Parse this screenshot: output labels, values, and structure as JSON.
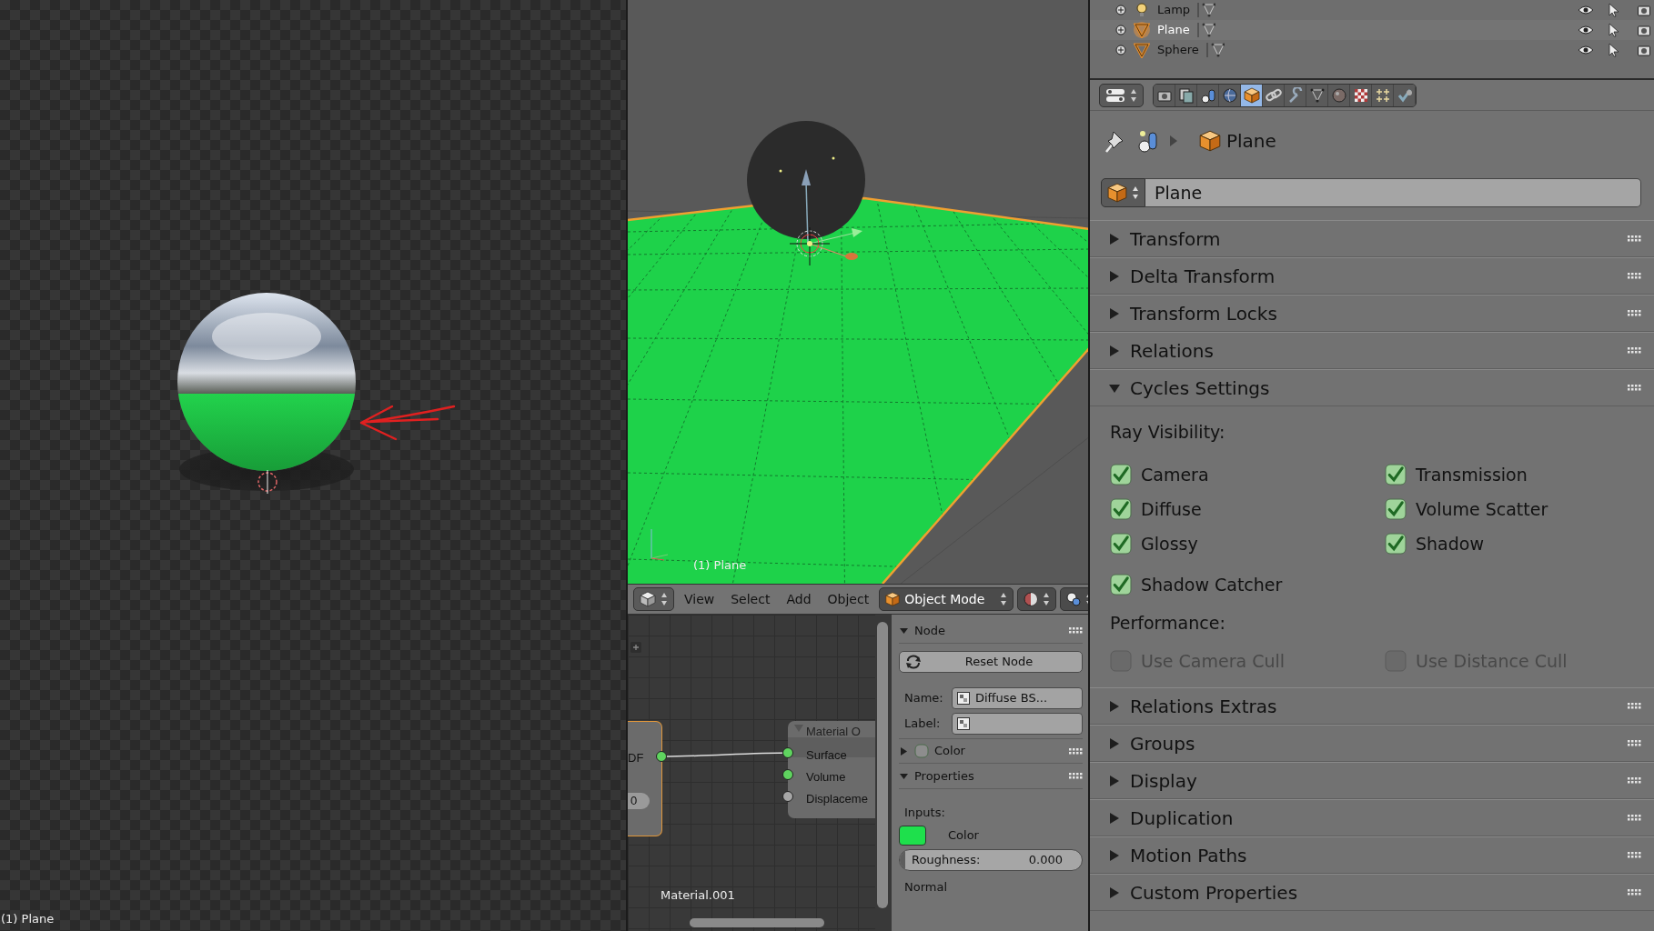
{
  "render_view": {
    "status": "(1) Plane"
  },
  "viewport": {
    "status": "(1) Plane"
  },
  "viewport_header": {
    "menus": [
      "View",
      "Select",
      "Add",
      "Object"
    ],
    "mode": "Object Mode"
  },
  "node_editor": {
    "left_node": {
      "socket": "DF",
      "field": "0"
    },
    "output_node": {
      "title": "Material O",
      "sockets": [
        {
          "name": "Surface",
          "color": "#5fd45f"
        },
        {
          "name": "Volume",
          "color": "#5fd45f"
        },
        {
          "name": "Displaceme",
          "color": "#a6a6a6"
        }
      ]
    },
    "material_name": "Material.001"
  },
  "node_panel": {
    "node_section": {
      "title": "Node",
      "expanded": true
    },
    "reset_button": "Reset Node",
    "name_label": "Name:",
    "name_value": "Diffuse BS...",
    "label_label": "Label:",
    "color_section": {
      "title": "Color",
      "expanded": false,
      "checked": false
    },
    "properties_section": {
      "title": "Properties",
      "expanded": true
    },
    "inputs_label": "Inputs:",
    "color_input": {
      "label": "Color",
      "color": "#1ee04c"
    },
    "roughness": {
      "label": "Roughness:",
      "value": "0.000",
      "level": 0
    },
    "normal_label": "Normal"
  },
  "outliner": {
    "rows": [
      {
        "name": "Lamp",
        "kind": "lamp",
        "selected": false
      },
      {
        "name": "Plane",
        "kind": "mesh",
        "selected": true
      },
      {
        "name": "Sphere",
        "kind": "mesh",
        "selected": false
      }
    ]
  },
  "properties": {
    "tabs": [
      {
        "selected": false
      },
      {
        "selected": false
      },
      {
        "selected": false
      },
      {
        "selected": false
      },
      {
        "selected": true
      },
      {
        "selected": false
      },
      {
        "selected": false
      },
      {
        "selected": false
      },
      {
        "selected": false
      },
      {
        "selected": false
      },
      {
        "selected": false
      },
      {
        "selected": false
      }
    ],
    "breadcrumb": "Plane",
    "object_name": "Plane",
    "panels": [
      {
        "title": "Transform",
        "expanded": false
      },
      {
        "title": "Delta Transform",
        "expanded": false
      },
      {
        "title": "Transform Locks",
        "expanded": false
      },
      {
        "title": "Relations",
        "expanded": false
      },
      {
        "title": "Cycles Settings",
        "expanded": true,
        "content": {
          "ray_visibility_label": "Ray Visibility:",
          "ray_visibility": [
            {
              "label": "Camera",
              "checked": true,
              "disabled": false
            },
            {
              "label": "Transmission",
              "checked": true,
              "disabled": false
            },
            {
              "label": "Diffuse",
              "checked": true,
              "disabled": false
            },
            {
              "label": "Volume Scatter",
              "checked": true,
              "disabled": false
            },
            {
              "label": "Glossy",
              "checked": true,
              "disabled": false
            },
            {
              "label": "Shadow",
              "checked": true,
              "disabled": false
            }
          ],
          "catcher_options": [
            {
              "label": "Shadow Catcher",
              "checked": true,
              "disabled": false
            }
          ],
          "performance_label": "Performance:",
          "performance": [
            {
              "label": "Use Camera Cull",
              "checked": false,
              "disabled": true
            },
            {
              "label": "Use Distance Cull",
              "checked": false,
              "disabled": true
            }
          ]
        }
      },
      {
        "title": "Relations Extras",
        "expanded": false
      },
      {
        "title": "Groups",
        "expanded": false
      },
      {
        "title": "Display",
        "expanded": false
      },
      {
        "title": "Duplication",
        "expanded": false
      },
      {
        "title": "Motion Paths",
        "expanded": false
      },
      {
        "title": "Custom Properties",
        "expanded": false
      }
    ]
  }
}
